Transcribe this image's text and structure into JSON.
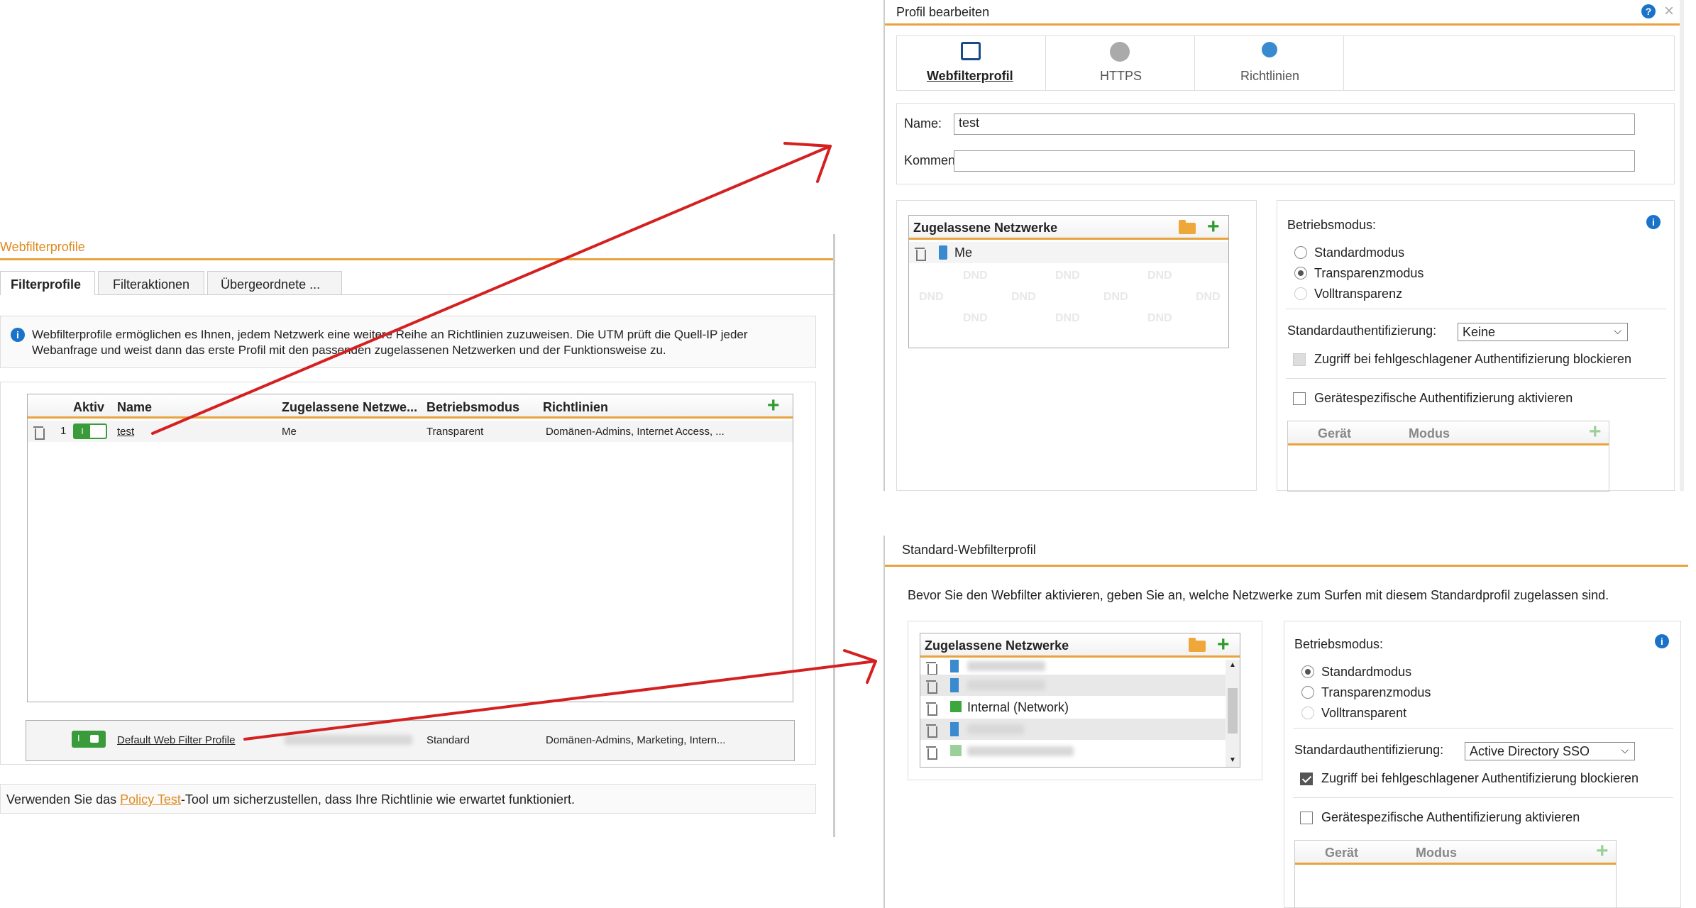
{
  "left": {
    "title": "Webfilterprofile",
    "tabs": [
      "Filterprofile",
      "Filteraktionen",
      "Übergeordnete ..."
    ],
    "info_text_1": "Webfilterprofile ermöglichen es Ihnen, jedem Netzwerk eine weitere Reihe an Richtlinien zuzuweisen. Die UTM prüft die Quell-IP jeder",
    "info_text_2": "Webanfrage und weist dann das erste Profil mit den passenden zugelassenen Netzwerken und der Funktionsweise zu.",
    "columns": [
      "Aktiv",
      "Name",
      "Zugelassene Netzwe...",
      "Betriebsmodus",
      "Richtlinien"
    ],
    "row": {
      "num": "1",
      "name": "test",
      "networks": "Me",
      "mode": "Transparent",
      "policies": "Domänen-Admins, Internet Access, ..."
    },
    "default_row": {
      "name": "Default Web Filter Profile",
      "mode": "Standard",
      "policies": "Domänen-Admins, Marketing, Intern..."
    },
    "footer_pre": "Verwenden Sie das ",
    "footer_link": "Policy Test",
    "footer_post": "-Tool um sicherzustellen, dass Ihre Richtlinie wie erwartet funktioniert."
  },
  "top_dialog": {
    "title": "Profil bearbeiten",
    "tabs": [
      "Webfilterprofil",
      "HTTPS",
      "Richtlinien"
    ],
    "name_label": "Name:",
    "name_value": "test",
    "comment_label": "Kommentar:",
    "comment_value": "",
    "networks_header": "Zugelassene Netzwerke",
    "network_item": "Me",
    "dnd": "DND",
    "mode_label": "Betriebsmodus:",
    "modes": [
      "Standardmodus",
      "Transparenzmodus",
      "Volltransparenz"
    ],
    "auth_label": "Standardauthentifizierung:",
    "auth_value": "Keine",
    "block_label": "Zugriff bei fehlgeschlagener Authentifizierung blockieren",
    "device_label": "Gerätespezifische Authentifizierung aktivieren",
    "device_cols": [
      "Gerät",
      "Modus"
    ]
  },
  "bottom_dialog": {
    "title": "Standard-Webfilterprofil",
    "intro": "Bevor Sie den Webfilter aktivieren, geben Sie an, welche Netzwerke zum Surfen mit diesem Standardprofil zugelassen sind.",
    "networks_header": "Zugelassene Netzwerke",
    "network_item": "Internal (Network)",
    "mode_label": "Betriebsmodus:",
    "modes": [
      "Standardmodus",
      "Transparenzmodus",
      "Volltransparent"
    ],
    "auth_label": "Standardauthentifizierung:",
    "auth_value": "Active Directory SSO",
    "block_label": "Zugriff bei fehlgeschlagener Authentifizierung blockieren",
    "device_label": "Gerätespezifische Authentifizierung aktivieren",
    "device_cols": [
      "Gerät",
      "Modus"
    ]
  },
  "colors": {
    "accent": "#e8a33d",
    "arrow": "#d42020",
    "info": "#1a73c8",
    "green": "#2d9b2d"
  }
}
